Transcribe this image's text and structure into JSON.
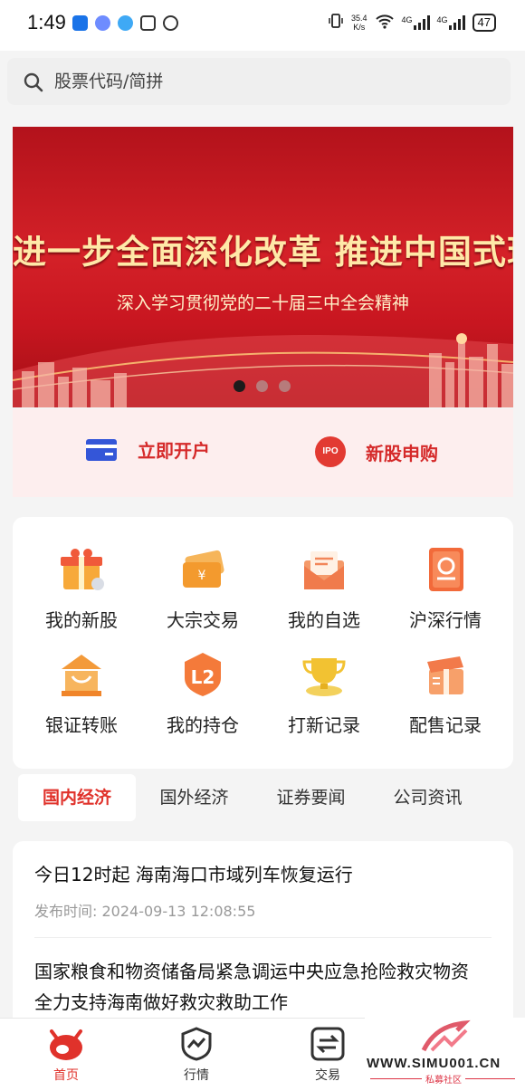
{
  "status": {
    "time": "1:49",
    "speed_value": "35.4",
    "speed_unit": "K/s",
    "net1": "4G",
    "net2": "4G",
    "battery": "47"
  },
  "search": {
    "placeholder": "股票代码/简拼"
  },
  "banner": {
    "title": "进一步全面深化改革  推进中国式现代化",
    "subtitle": "深入学习贯彻党的二十届三中全会精神",
    "dots": 3,
    "active_dot": 0
  },
  "quick_actions": {
    "open_account": "立即开户",
    "ipo_badge": "IPO",
    "ipo_subscribe": "新股申购"
  },
  "grid": [
    {
      "label": "我的新股",
      "icon": "gift-icon"
    },
    {
      "label": "大宗交易",
      "icon": "yen-ticket-icon"
    },
    {
      "label": "我的自选",
      "icon": "envelope-icon"
    },
    {
      "label": "沪深行情",
      "icon": "market-doc-icon"
    },
    {
      "label": "银证转账",
      "icon": "bank-transfer-icon"
    },
    {
      "label": "我的持仓",
      "icon": "l2-badge-icon"
    },
    {
      "label": "打新记录",
      "icon": "trophy-icon"
    },
    {
      "label": "配售记录",
      "icon": "gift-box-icon"
    }
  ],
  "tabs": [
    {
      "label": "国内经济",
      "active": true
    },
    {
      "label": "国外经济",
      "active": false
    },
    {
      "label": "证券要闻",
      "active": false
    },
    {
      "label": "公司资讯",
      "active": false
    }
  ],
  "news": [
    {
      "title": "今日12时起 海南海口市域列车恢复运行",
      "time_label": "发布时间:",
      "time": "2024-09-13 12:08:55"
    },
    {
      "title": "国家粮食和物资储备局紧急调运中央应急抢险救灾物资 全力支持海南做好救灾救助工作"
    }
  ],
  "bottom_nav": [
    {
      "label": "首页",
      "active": true
    },
    {
      "label": "行情",
      "active": false
    },
    {
      "label": "交易",
      "active": false
    }
  ],
  "watermark": {
    "url": "WWW.SIMU001.CN",
    "sub": "私募社区"
  },
  "colors": {
    "accent": "#e0322b",
    "banner_red": "#c81620",
    "quick_bg": "#fdeeee"
  }
}
